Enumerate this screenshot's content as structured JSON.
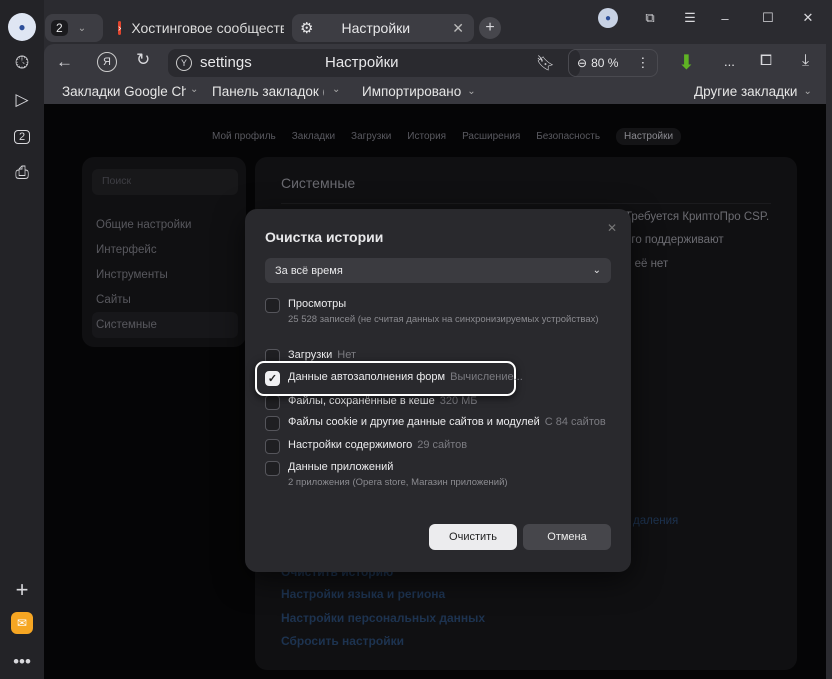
{
  "window": {
    "tab_count": "2",
    "tabs": [
      {
        "label": "Хостинговое сообщество"
      },
      {
        "label": "Настройки"
      }
    ]
  },
  "toolbar": {
    "address": "settings",
    "page_title": "Настройки",
    "zoom": "80 %",
    "more": "..."
  },
  "bookmarks": {
    "items": [
      "Закладки Google Ch",
      "Панель закладок (Ec",
      "Импортировано"
    ],
    "other": "Другие закладки"
  },
  "sidebar": {
    "count_badge": "2"
  },
  "settings_nav": [
    "Мой профиль",
    "Закладки",
    "Загрузки",
    "История",
    "Расширения",
    "Безопасность",
    "Настройки"
  ],
  "settings_sidebar": {
    "search_placeholder": "Поиск",
    "items": [
      "Общие настройки",
      "Интерфейс",
      "Инструменты",
      "Сайты",
      "Системные"
    ]
  },
  "main": {
    "section_title": "Системные",
    "background_texts": [
      "Требуется КриптоПро CSP.",
      "его поддерживают",
      "о её нет",
      "даления"
    ],
    "links": [
      "Очистить историю",
      "Настройки языка и региона",
      "Настройки персональных данных",
      "Сбросить настройки"
    ]
  },
  "dialog": {
    "title": "Очистка истории",
    "period": "За всё время",
    "items": [
      {
        "label": "Просмотры",
        "detail": "",
        "sub": "25 528 записей (не считая данных на синхронизируемых устройствах)",
        "checked": false
      },
      {
        "label": "Загрузки",
        "detail": "Нет",
        "sub": "",
        "checked": false
      },
      {
        "label": "Данные автозаполнения форм",
        "detail": "Вычисление...",
        "sub": "",
        "checked": true
      },
      {
        "label": "Файлы, сохранённые в кеше",
        "detail": "320 МБ",
        "sub": "",
        "checked": false
      },
      {
        "label": "Файлы cookie и другие данные сайтов и модулей",
        "detail": "С 84 сайтов",
        "sub": "",
        "checked": false
      },
      {
        "label": "Настройки содержимого",
        "detail": "29 сайтов",
        "sub": "",
        "checked": false
      },
      {
        "label": "Данные приложений",
        "detail": "",
        "sub": "2 приложения (Opera store, Магазин приложений)",
        "checked": false
      }
    ],
    "clear_button": "Очистить",
    "cancel_button": "Отмена"
  },
  "colors": {
    "accent_highlight": "#ffffff",
    "download_icon": "#5fb324",
    "tab_favicon": "#e0442d"
  }
}
